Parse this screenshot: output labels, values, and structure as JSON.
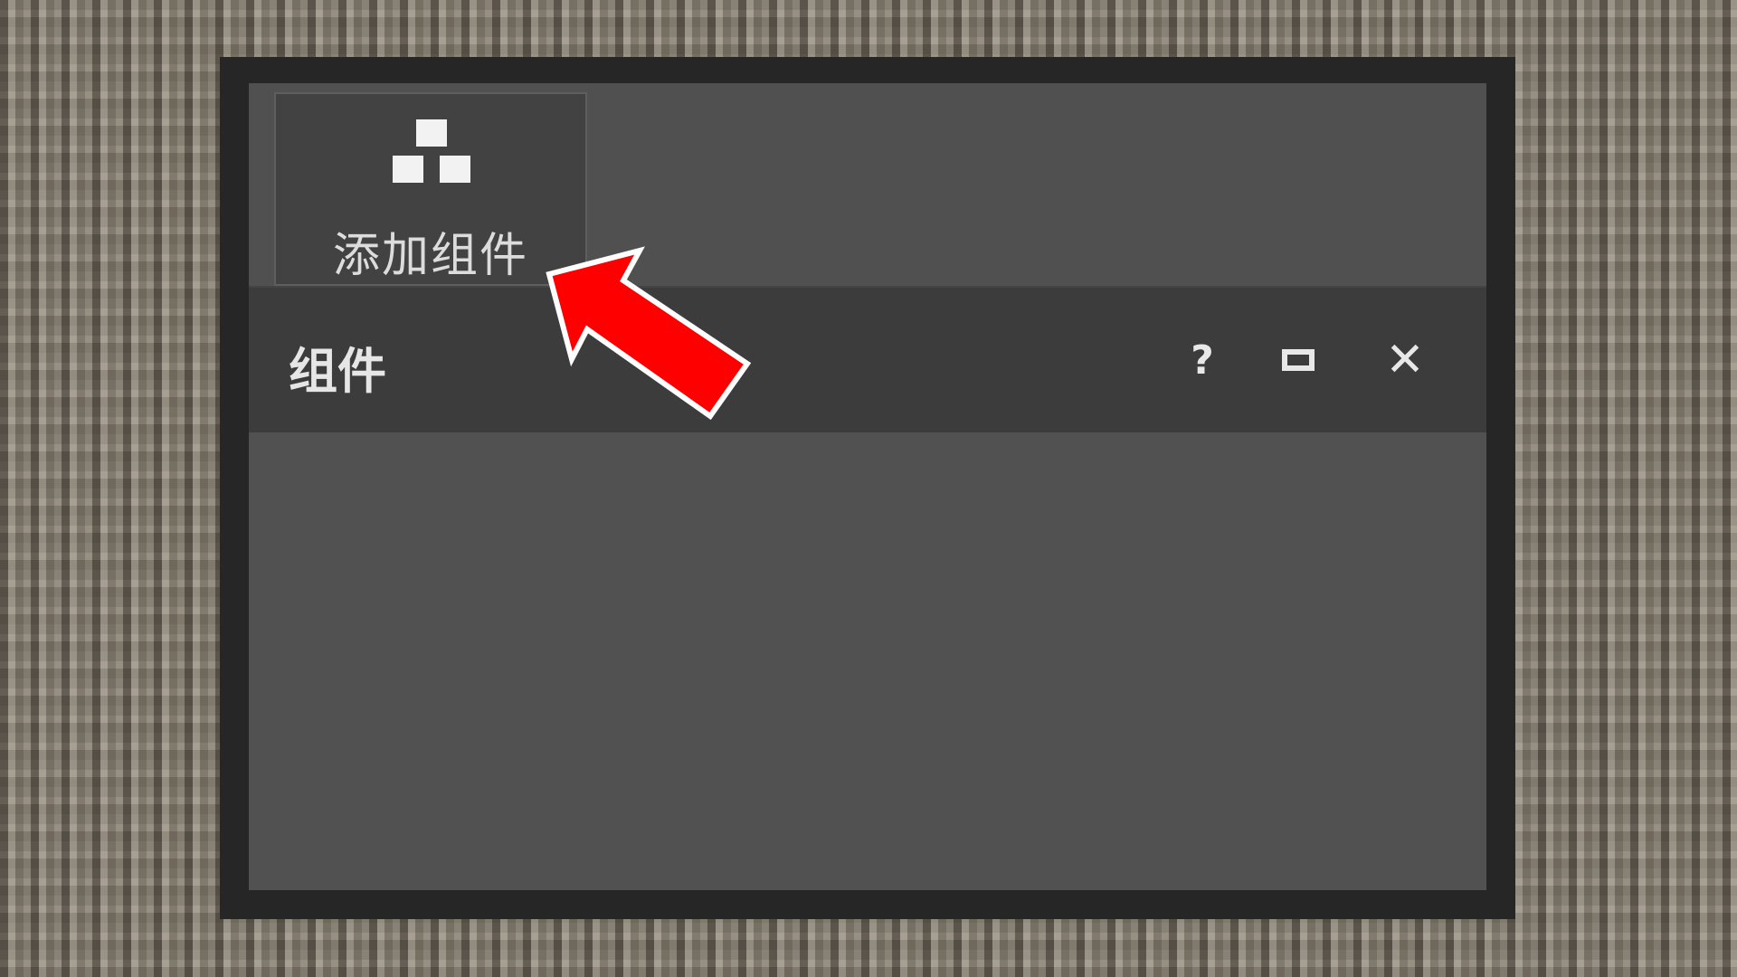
{
  "toolbar": {
    "add_component_label": "添加组件"
  },
  "panel": {
    "title": "组件",
    "help_label": "?",
    "close_label": "✕"
  },
  "icons": {
    "add": "add-component-icon",
    "maximize": "maximize-icon",
    "close": "close-icon",
    "annotation": "red-arrow-icon"
  },
  "colors": {
    "arrow": "#ff0000",
    "arrow_outline": "#ffffff"
  }
}
